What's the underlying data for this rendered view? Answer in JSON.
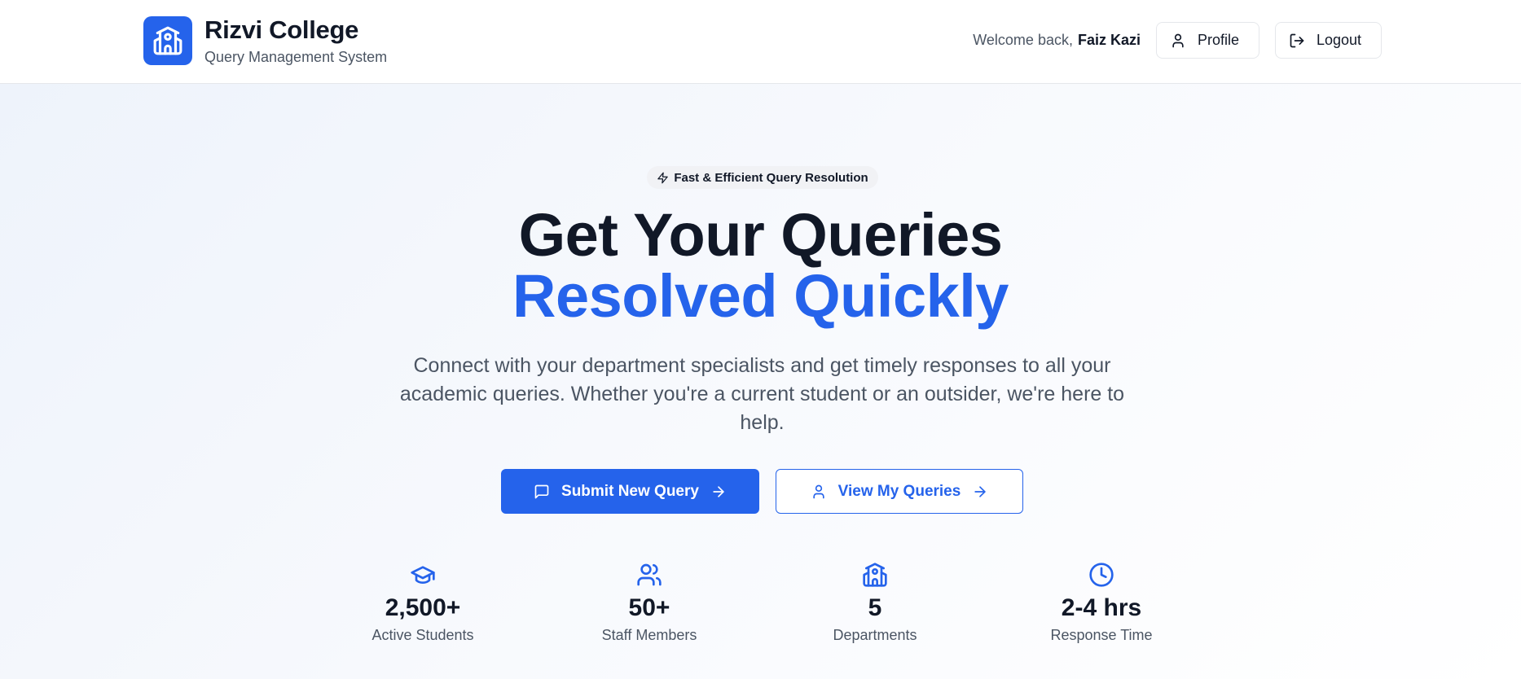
{
  "header": {
    "brand_title": "Rizvi College",
    "brand_subtitle": "Query Management System",
    "welcome_text": "Welcome back,",
    "user_name": "Faiz Kazi",
    "profile_label": "Profile",
    "logout_label": "Logout"
  },
  "hero": {
    "badge_text": "Fast & Efficient Query Resolution",
    "headline_line1": "Get Your Queries",
    "headline_line2": "Resolved Quickly",
    "description": "Connect with your department specialists and get timely responses to all your academic queries. Whether you're a current student or an outsider, we're here to help.",
    "primary_cta": "Submit New Query",
    "secondary_cta": "View My Queries"
  },
  "stats": [
    {
      "icon": "graduation-cap-icon",
      "value": "2,500+",
      "label": "Active Students"
    },
    {
      "icon": "users-icon",
      "value": "50+",
      "label": "Staff Members"
    },
    {
      "icon": "school-icon",
      "value": "5",
      "label": "Departments"
    },
    {
      "icon": "clock-icon",
      "value": "2-4 hrs",
      "label": "Response Time"
    }
  ],
  "colors": {
    "accent": "#2563eb",
    "text_dark": "#111827",
    "text_muted": "#4b5563",
    "border": "#e5e7eb"
  }
}
